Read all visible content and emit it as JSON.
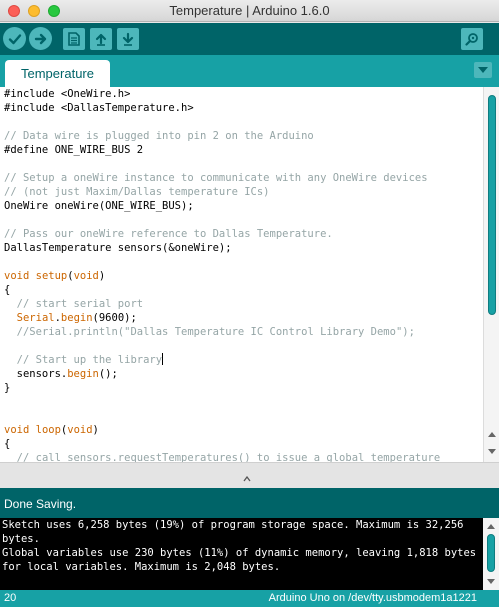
{
  "window": {
    "title": "Temperature | Arduino 1.6.0"
  },
  "toolbar": {
    "buttons": [
      {
        "name": "verify",
        "icon": "check-icon"
      },
      {
        "name": "upload",
        "icon": "arrow-right-icon"
      },
      {
        "name": "new",
        "icon": "new-file-icon"
      },
      {
        "name": "open",
        "icon": "arrow-up-icon"
      },
      {
        "name": "save",
        "icon": "arrow-down-icon"
      },
      {
        "name": "serial-monitor",
        "icon": "magnifier-icon"
      }
    ]
  },
  "tabs": {
    "active": "Temperature"
  },
  "editor": {
    "lines": [
      [
        {
          "t": "#include <OneWire.h>"
        }
      ],
      [
        {
          "t": "#include <DallasTemperature.h>"
        }
      ],
      [
        {
          "t": ""
        }
      ],
      [
        {
          "t": "// Data wire is plugged into pin 2 on the Arduino",
          "c": "cm"
        }
      ],
      [
        {
          "t": "#define ONE_WIRE_BUS 2"
        }
      ],
      [
        {
          "t": ""
        }
      ],
      [
        {
          "t": "// Setup a oneWire instance to communicate with any OneWire devices",
          "c": "cm"
        }
      ],
      [
        {
          "t": "// (not just Maxim/Dallas temperature ICs)",
          "c": "cm"
        }
      ],
      [
        {
          "t": "OneWire oneWire(ONE_WIRE_BUS);"
        }
      ],
      [
        {
          "t": ""
        }
      ],
      [
        {
          "t": "// Pass our oneWire reference to Dallas Temperature.",
          "c": "cm"
        }
      ],
      [
        {
          "t": "DallasTemperature sensors(&oneWire);"
        }
      ],
      [
        {
          "t": ""
        }
      ],
      [
        {
          "t": "void",
          "c": "kw"
        },
        {
          "t": " "
        },
        {
          "t": "setup",
          "c": "fn"
        },
        {
          "t": "("
        },
        {
          "t": "void",
          "c": "kw"
        },
        {
          "t": ")"
        }
      ],
      [
        {
          "t": "{"
        }
      ],
      [
        {
          "t": "  "
        },
        {
          "t": "// start serial port",
          "c": "cm"
        }
      ],
      [
        {
          "t": "  "
        },
        {
          "t": "Serial",
          "c": "kw"
        },
        {
          "t": "."
        },
        {
          "t": "begin",
          "c": "fn"
        },
        {
          "t": "(9600);"
        }
      ],
      [
        {
          "t": "  "
        },
        {
          "t": "//Serial.println(\"Dallas Temperature IC Control Library Demo\");",
          "c": "cm"
        }
      ],
      [
        {
          "t": ""
        }
      ],
      [
        {
          "t": "  "
        },
        {
          "t": "// Start up the library",
          "c": "cm"
        },
        {
          "caret": true
        }
      ],
      [
        {
          "t": "  sensors."
        },
        {
          "t": "begin",
          "c": "fn"
        },
        {
          "t": "();"
        }
      ],
      [
        {
          "t": "}"
        }
      ],
      [
        {
          "t": ""
        }
      ],
      [
        {
          "t": ""
        }
      ],
      [
        {
          "t": "void",
          "c": "kw"
        },
        {
          "t": " "
        },
        {
          "t": "loop",
          "c": "fn"
        },
        {
          "t": "("
        },
        {
          "t": "void",
          "c": "kw"
        },
        {
          "t": ")"
        }
      ],
      [
        {
          "t": "{"
        }
      ],
      [
        {
          "t": "  "
        },
        {
          "t": "// call sensors.requestTemperatures() to issue a global temperature",
          "c": "cm"
        }
      ]
    ]
  },
  "status": {
    "message": "Done Saving."
  },
  "console": {
    "lines": [
      "Sketch uses 6,258 bytes (19%) of program storage space. Maximum is 32,256",
      "bytes.",
      "Global variables use 230 bytes (11%) of dynamic memory, leaving 1,818 bytes",
      "for local variables. Maximum is 2,048 bytes."
    ]
  },
  "footer": {
    "line_number": "20",
    "board": "Arduino Uno on /dev/tty.usbmodem1a1221"
  },
  "colors": {
    "toolbar": "#006468",
    "tabbar": "#17a1a5",
    "button": "#4db7bb",
    "keyword": "#cc6600",
    "comment": "#95a5a6"
  }
}
